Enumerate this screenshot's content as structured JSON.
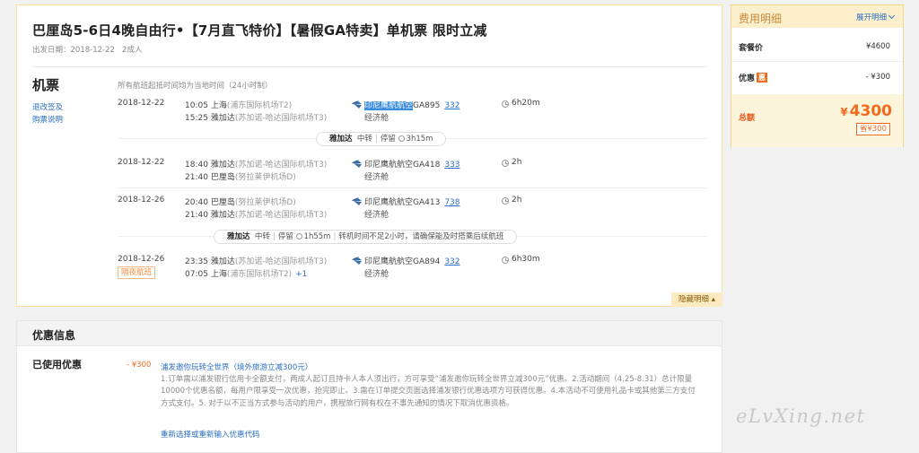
{
  "product": {
    "title": "巴厘岛5-6日4晚自由行•【7月直飞特价】【暑假GA特卖】单机票 限时立减",
    "departure_label": "出发日期：",
    "departure_date": "2018-12-22",
    "travelers": "2成人"
  },
  "flights": {
    "section_title": "机票",
    "time_note": "所有航班起抵时间均为当地时间（24小时制）",
    "refund_link": "退改签及",
    "purchase_link": "购票说明",
    "next_day_tag": "隔夜航班",
    "collapse_label": "隐藏明细",
    "segments": [
      {
        "date": "2018-12-22",
        "dep_time": "10:05",
        "dep_city": "上海",
        "dep_airport": "(浦东国际机场T2)",
        "arr_time": "15:25",
        "arr_city": "雅加达",
        "arr_airport": "(苏加诺-哈达国际机场T3)",
        "airline_highlight": "印尼鹰航航空",
        "flight_no": "GA895",
        "plane": "332",
        "cabin": "经济舱",
        "duration": "6h20m"
      },
      {
        "date": "2018-12-22",
        "dep_time": "18:40",
        "dep_city": "雅加达",
        "dep_airport": "(苏加诺-哈达国际机场T3)",
        "arr_time": "21:40",
        "arr_city": "巴厘岛",
        "arr_airport": "(努拉莱伊机场D)",
        "airline": "印尼鹰航航空GA418",
        "plane": "333",
        "cabin": "经济舱",
        "duration": "2h"
      },
      {
        "date": "2018-12-26",
        "dep_time": "20:40",
        "dep_city": "巴厘岛",
        "dep_airport": "(努拉莱伊机场D)",
        "arr_time": "21:40",
        "arr_city": "雅加达",
        "arr_airport": "(苏加诺-哈达国际机场T3)",
        "airline": "印尼鹰航航空GA413",
        "plane": "738",
        "cabin": "经济舱",
        "duration": "2h"
      },
      {
        "date": "2018-12-26",
        "dep_time": "23:35",
        "dep_city": "雅加达",
        "dep_airport": "(苏加诺-哈达国际机场T3)",
        "arr_time": "07:05",
        "arr_city": "上海",
        "arr_airport": "(浦东国际机场T2)",
        "next_day": "+1",
        "airline": "印尼鹰航航空GA894",
        "plane": "332",
        "cabin": "经济舱",
        "duration": "6h30m"
      }
    ],
    "transfers": [
      {
        "city": "雅加达",
        "type": "中转",
        "stay": "停留",
        "time": "3h15m"
      },
      {
        "city": "雅加达",
        "type": "中转",
        "stay": "停留",
        "time": "1h55m",
        "warning": "转机时间不足2小时，请确保能及时搭乘后续航班"
      }
    ]
  },
  "fee": {
    "title": "费用明细",
    "expand": "展开明细",
    "package_label": "套餐价",
    "package_value": "¥4600",
    "discount_label": "优惠",
    "discount_badge": "惠",
    "discount_value": "- ¥300",
    "total_label": "总额",
    "total_currency": "¥",
    "total_value": "4300",
    "save_badge": "省¥300"
  },
  "promo": {
    "section_title": "优惠信息",
    "used_label": "已使用优惠",
    "amount": "- ¥300",
    "name": "浦发邀你玩转全世界（境外旅游立减300元）",
    "description": "1.订单需以浦发银行信用卡全额支付，两成人起订且持卡人本人须出行，方可享受“浦发邀你玩转全世界立减300元”优惠。2.活动期间（4.25-8.31）总计限量10000个优惠名额，每用户限享受一次优惠，抢完即止。3.需在订单提交页面选择浦发银行优惠选项方可获得优惠。4.本活动不可使用礼品卡或其他第三方支付方式支付。5. 对于以不正当方式参与活动的用户，携程旅行网有权在不事先通知的情况下取消优惠资格。",
    "reselect_link": "重新选择或重新输入优惠代码"
  },
  "watermark": "eLvXing.net",
  "colors": {
    "accent_orange": "#f26b1d",
    "link_blue": "#2a6ec4",
    "header_gold": "#c58a3a"
  }
}
